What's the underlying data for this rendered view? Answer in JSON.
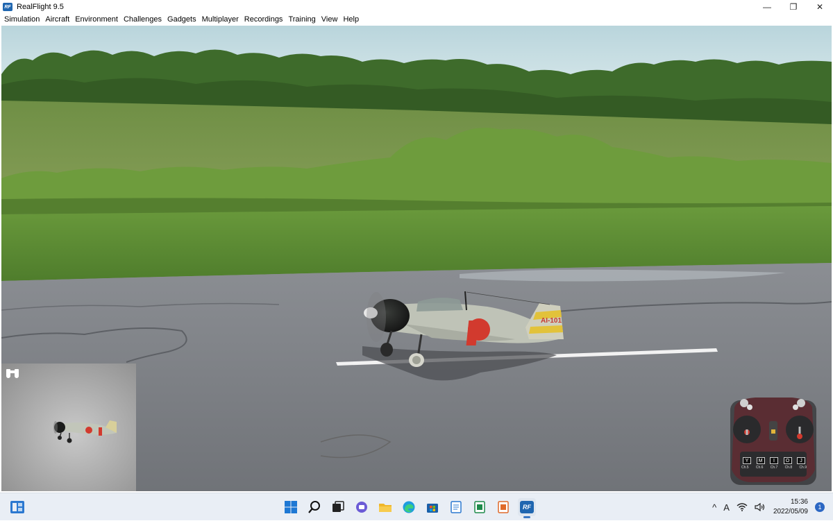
{
  "window": {
    "app_icon_text": "RF",
    "title": "RealFlight 9.5",
    "minimize": "—",
    "maximize": "❐",
    "close": "✕"
  },
  "menu": [
    {
      "label": "Simulation"
    },
    {
      "label": "Aircraft"
    },
    {
      "label": "Environment"
    },
    {
      "label": "Challenges"
    },
    {
      "label": "Gadgets"
    },
    {
      "label": "Multiplayer"
    },
    {
      "label": "Recordings"
    },
    {
      "label": "Training"
    },
    {
      "label": "View"
    },
    {
      "label": "Help"
    }
  ],
  "scene": {
    "aircraft_code": "AI-101",
    "colors": {
      "sky": "#c6dde3",
      "trees": "#3d6a2a",
      "field": "#7c9950",
      "grass": "#5e8a36",
      "runway": "#7f8187",
      "hinomaru": "#d23a2e",
      "aircraft_body": "#b9bdb2",
      "tail_yellow": "#e2c23a"
    }
  },
  "inset_camera": {
    "icon": "binoculars-icon"
  },
  "transmitter": {
    "icon": "transmitter-icon",
    "keys": [
      "Y",
      "M",
      "I",
      "O",
      "J"
    ],
    "channels": [
      "Ch.5",
      "Ch.6",
      "Ch.7",
      "Ch.8",
      "Ch.9"
    ]
  },
  "taskbar": {
    "apps": [
      {
        "name": "start-button",
        "icon": "windows-icon"
      },
      {
        "name": "search-button",
        "icon": "search-icon"
      },
      {
        "name": "task-view-button",
        "icon": "task-view-icon"
      },
      {
        "name": "chat-button",
        "icon": "chat-icon"
      },
      {
        "name": "file-explorer-button",
        "icon": "folder-icon"
      },
      {
        "name": "edge-button",
        "icon": "edge-icon"
      },
      {
        "name": "store-button",
        "icon": "store-icon"
      },
      {
        "name": "notepad-button",
        "icon": "notepad-icon"
      },
      {
        "name": "excel-button",
        "icon": "spreadsheet-icon"
      },
      {
        "name": "document-button",
        "icon": "document-icon"
      },
      {
        "name": "realflight-button",
        "icon": "realflight-icon",
        "label": "RF"
      }
    ],
    "tray": {
      "chevron": "^",
      "ime": "A",
      "time": "15:36",
      "date": "2022/05/09",
      "notification_count": "1"
    }
  }
}
